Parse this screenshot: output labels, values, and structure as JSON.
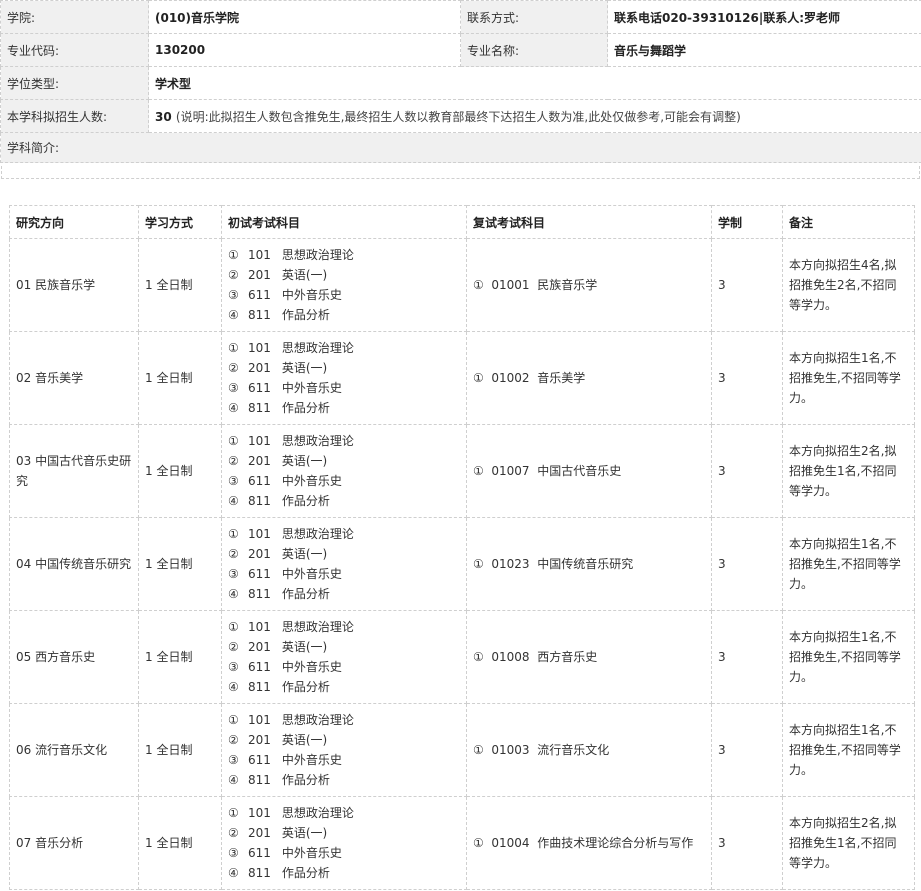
{
  "info": {
    "college_label": "学院:",
    "college_value": "(010)音乐学院",
    "contact_label": "联系方式:",
    "contact_value": "联系电话020-39310126|联系人:罗老师",
    "major_code_label": "专业代码:",
    "major_code_value": "130200",
    "major_name_label": "专业名称:",
    "major_name_value": "音乐与舞蹈学",
    "degree_label": "学位类型:",
    "degree_value": "学术型",
    "enroll_label": "本学科拟招生人数:",
    "enroll_value": "30",
    "enroll_note": "(说明:此拟招生人数包含推免生,最终招生人数以教育部最终下达招生人数为准,此处仅做参考,可能会有调整)",
    "intro_label": "学科简介:"
  },
  "table": {
    "headers": {
      "direction": "研究方向",
      "mode": "学习方式",
      "prelim": "初试考试科目",
      "retest": "复试考试科目",
      "years": "学制",
      "remark": "备注"
    },
    "rows": [
      {
        "direction": "01 民族音乐学",
        "mode": "1 全日制",
        "p1n": "①",
        "p1c": "101",
        "p1s": "思想政治理论",
        "p2n": "②",
        "p2c": "201",
        "p2s": "英语(一)",
        "p3n": "③",
        "p3c": "611",
        "p3s": "中外音乐史",
        "p4n": "④",
        "p4c": "811",
        "p4s": "作品分析",
        "retest": "①  01001  民族音乐学",
        "years": "3",
        "remark": "本方向拟招生4名,拟招推免生2名,不招同等学力。"
      },
      {
        "direction": "02 音乐美学",
        "mode": "1 全日制",
        "p1n": "①",
        "p1c": "101",
        "p1s": "思想政治理论",
        "p2n": "②",
        "p2c": "201",
        "p2s": "英语(一)",
        "p3n": "③",
        "p3c": "611",
        "p3s": "中外音乐史",
        "p4n": "④",
        "p4c": "811",
        "p4s": "作品分析",
        "retest": "①  01002  音乐美学",
        "years": "3",
        "remark": "本方向拟招生1名,不招推免生,不招同等学力。"
      },
      {
        "direction": "03 中国古代音乐史研究",
        "mode": "1 全日制",
        "p1n": "①",
        "p1c": "101",
        "p1s": "思想政治理论",
        "p2n": "②",
        "p2c": "201",
        "p2s": "英语(一)",
        "p3n": "③",
        "p3c": "611",
        "p3s": "中外音乐史",
        "p4n": "④",
        "p4c": "811",
        "p4s": "作品分析",
        "retest": "①  01007  中国古代音乐史",
        "years": "3",
        "remark": "本方向拟招生2名,拟招推免生1名,不招同等学力。"
      },
      {
        "direction": "04 中国传统音乐研究",
        "mode": "1 全日制",
        "p1n": "①",
        "p1c": "101",
        "p1s": "思想政治理论",
        "p2n": "②",
        "p2c": "201",
        "p2s": "英语(一)",
        "p3n": "③",
        "p3c": "611",
        "p3s": "中外音乐史",
        "p4n": "④",
        "p4c": "811",
        "p4s": "作品分析",
        "retest": "①  01023  中国传统音乐研究",
        "years": "3",
        "remark": "本方向拟招生1名,不招推免生,不招同等学力。"
      },
      {
        "direction": "05 西方音乐史",
        "mode": "1 全日制",
        "p1n": "①",
        "p1c": "101",
        "p1s": "思想政治理论",
        "p2n": "②",
        "p2c": "201",
        "p2s": "英语(一)",
        "p3n": "③",
        "p3c": "611",
        "p3s": "中外音乐史",
        "p4n": "④",
        "p4c": "811",
        "p4s": "作品分析",
        "retest": "①  01008  西方音乐史",
        "years": "3",
        "remark": "本方向拟招生1名,不招推免生,不招同等学力。"
      },
      {
        "direction": "06 流行音乐文化",
        "mode": "1 全日制",
        "p1n": "①",
        "p1c": "101",
        "p1s": "思想政治理论",
        "p2n": "②",
        "p2c": "201",
        "p2s": "英语(一)",
        "p3n": "③",
        "p3c": "611",
        "p3s": "中外音乐史",
        "p4n": "④",
        "p4c": "811",
        "p4s": "作品分析",
        "retest": "①  01003  流行音乐文化",
        "years": "3",
        "remark": "本方向拟招生1名,不招推免生,不招同等学力。"
      },
      {
        "direction": "07 音乐分析",
        "mode": "1 全日制",
        "p1n": "①",
        "p1c": "101",
        "p1s": "思想政治理论",
        "p2n": "②",
        "p2c": "201",
        "p2s": "英语(一)",
        "p3n": "③",
        "p3c": "611",
        "p3s": "中外音乐史",
        "p4n": "④",
        "p4c": "811",
        "p4s": "作品分析",
        "retest": "①  01004  作曲技术理论综合分析与写作",
        "years": "3",
        "remark": "本方向拟招生2名,拟招推免生1名,不招同等学力。"
      }
    ]
  }
}
